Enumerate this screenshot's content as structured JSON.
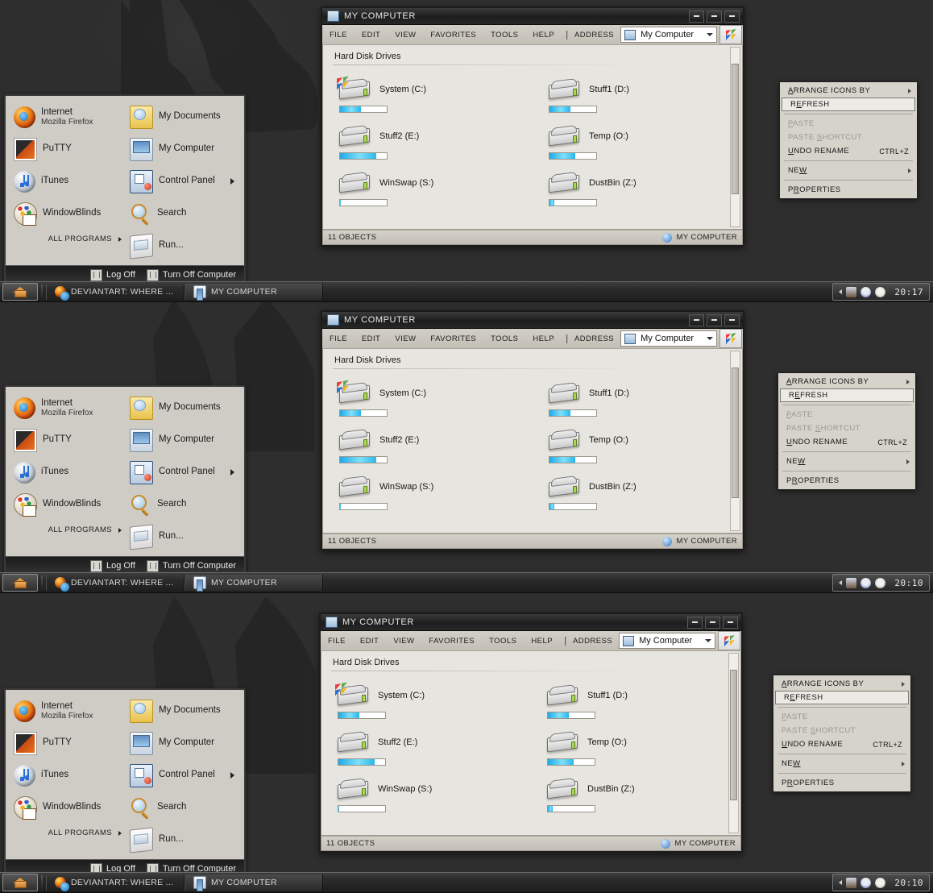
{
  "desktop": {
    "wallpaper_color": "#2f2f2f",
    "accent_color": "#1fa9e6"
  },
  "start_menu": {
    "left_items": [
      {
        "label": "Internet",
        "sub": "Mozilla Firefox",
        "icon": "firefox-icon"
      },
      {
        "label": "PuTTY",
        "sub": "",
        "icon": "putty-icon"
      },
      {
        "label": "iTunes",
        "sub": "",
        "icon": "itunes-icon"
      },
      {
        "label": "WindowBlinds",
        "sub": "",
        "icon": "windowblinds-icon"
      }
    ],
    "right_items": [
      {
        "label": "My Documents",
        "icon": "documents-icon",
        "arrow": false
      },
      {
        "label": "My Computer",
        "icon": "mycomputer-icon",
        "arrow": false
      },
      {
        "label": "Control Panel",
        "icon": "controlpanel-icon",
        "arrow": true
      },
      {
        "label": "Search",
        "icon": "search-icon",
        "arrow": false
      },
      {
        "label": "Run...",
        "icon": "run-icon",
        "arrow": false
      }
    ],
    "all_programs": "ALL PROGRAMS",
    "log_off": "Log Off",
    "turn_off": "Turn Off Computer"
  },
  "explorer": {
    "title": "MY COMPUTER",
    "menu": [
      "FILE",
      "EDIT",
      "VIEW",
      "FAVORITES",
      "TOOLS",
      "HELP"
    ],
    "address_label": "ADDRESS",
    "address_value": "My Computer",
    "group_heading": "Hard Disk Drives",
    "drives": [
      {
        "name": "System (C:)",
        "fill": 45,
        "windows_flag": true
      },
      {
        "name": "Stuff1 (D:)",
        "fill": 45,
        "windows_flag": false
      },
      {
        "name": "Stuff2 (E:)",
        "fill": 78,
        "windows_flag": false
      },
      {
        "name": "Temp (O:)",
        "fill": 55,
        "windows_flag": false
      },
      {
        "name": "WinSwap (S:)",
        "fill": 2,
        "windows_flag": false
      },
      {
        "name": "DustBin (Z:)",
        "fill": 10,
        "windows_flag": false
      }
    ],
    "status_left": "11 OBJECTS",
    "status_right": "MY COMPUTER"
  },
  "context_menu": {
    "items": [
      {
        "label": "ARRANGE ICONS BY",
        "accel": "A",
        "shortcut": "",
        "submenu": true,
        "disabled": false,
        "selected": false
      },
      {
        "label": "REFRESH",
        "accel": "E",
        "shortcut": "",
        "submenu": false,
        "disabled": false,
        "selected": true
      },
      {
        "label": "PASTE",
        "accel": "P",
        "shortcut": "",
        "submenu": false,
        "disabled": true,
        "selected": false
      },
      {
        "label": "PASTE SHORTCUT",
        "accel": "S",
        "shortcut": "",
        "submenu": false,
        "disabled": true,
        "selected": false
      },
      {
        "label": "UNDO RENAME",
        "accel": "U",
        "shortcut": "CTRL+Z",
        "submenu": false,
        "disabled": false,
        "selected": false
      },
      {
        "label": "NEW",
        "accel": "W",
        "shortcut": "",
        "submenu": true,
        "disabled": false,
        "selected": false
      },
      {
        "label": "PROPERTIES",
        "accel": "R",
        "shortcut": "",
        "submenu": false,
        "disabled": false,
        "selected": false
      }
    ]
  },
  "taskbar": {
    "start_label": "",
    "buttons": [
      {
        "label": "DEVIANTART: WHERE ...",
        "icon": "firefox-icon",
        "active": false
      },
      {
        "label": "MY COMPUTER",
        "icon": "mycomputer-icon",
        "active": true
      }
    ],
    "tray_icons": [
      "screen-icon",
      "skull-icon",
      "gear-icon"
    ],
    "clocks": [
      "20:17",
      "20:10",
      "20:10"
    ]
  }
}
